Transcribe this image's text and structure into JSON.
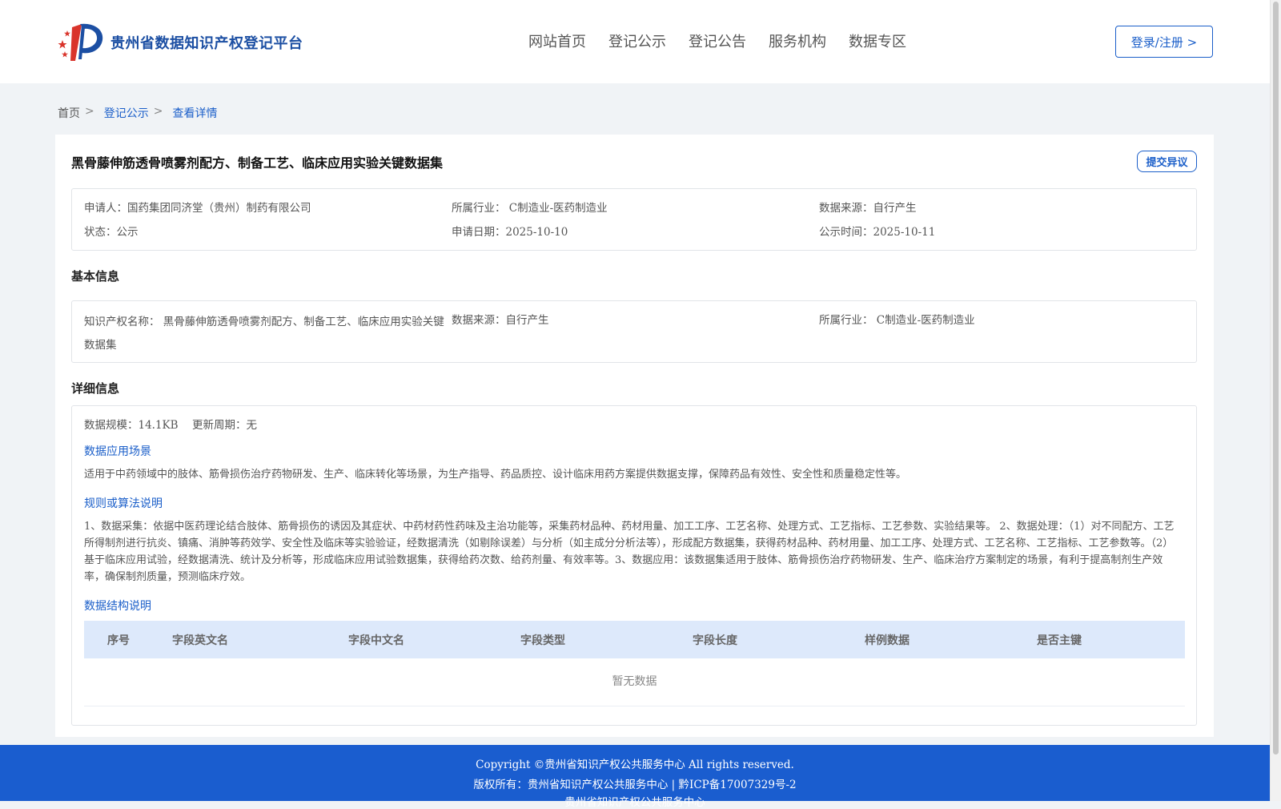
{
  "header": {
    "site_title": "贵州省数据知识产权登记平台",
    "nav": [
      "网站首页",
      "登记公示",
      "登记公告",
      "服务机构",
      "数据专区"
    ],
    "login_label": "登录/注册 >"
  },
  "breadcrumb": {
    "home": "首页",
    "section": "登记公示",
    "current": "查看详情",
    "separator": ">"
  },
  "record": {
    "title": "黑骨藤伸筋透骨喷雾剂配方、制备工艺、临床应用实验关键数据集",
    "dispute_label": "提交异议",
    "summary": {
      "applicant": "申请人：国药集团同济堂（贵州）制药有限公司",
      "industry": "所属行业： C制造业-医药制造业",
      "source": "数据来源：自行产生",
      "status": "状态：公示",
      "apply_date": "申请日期：2025-10-10",
      "publish_date": "公示时间：2025-10-11"
    }
  },
  "basic": {
    "heading": "基本信息",
    "name": "知识产权名称： 黑骨藤伸筋透骨喷雾剂配方、制备工艺、临床应用实验关键数据集",
    "source": "数据来源：自行产生",
    "industry": "所属行业： C制造业-医药制造业"
  },
  "detail": {
    "heading": "详细信息",
    "scale": "数据规模：14.1KB",
    "cycle": "更新周期：无",
    "scenario_heading": "数据应用场景",
    "scenario_text": "适用于中药领域中的肢体、筋骨损伤治疗药物研发、生产、临床转化等场景，为生产指导、药品质控、设计临床用药方案提供数据支撑，保障药品有效性、安全性和质量稳定性等。",
    "rules_heading": "规则或算法说明",
    "rules_text": "1、数据采集：依据中医药理论结合肢体、筋骨损伤的诱因及其症状、中药材药性药味及主治功能等，采集药材品种、药材用量、加工工序、工艺名称、处理方式、工艺指标、工艺参数、实验结果等。 2、数据处理：（1）对不同配方、工艺所得制剂进行抗炎、镇痛、消肿等药效学、安全性及临床等实验验证，经数据清洗（如剔除误差）与分析（如主成分分析法等），形成配方数据集，获得药材品种、药材用量、加工工序、处理方式、工艺名称、工艺指标、工艺参数等。（2）基于临床应用试验，经数据清洗、统计及分析等，形成临床应用试验数据集，获得给药次数、给药剂量、有效率等。3、数据应用：该数据集适用于肢体、筋骨损伤治疗药物研发、生产、临床治疗方案制定的场景，有利于提高制剂生产效率，确保制剂质量，预测临床疗效。",
    "structure_heading": "数据结构说明",
    "table_headers": [
      "序号",
      "字段英文名",
      "字段中文名",
      "字段类型",
      "字段长度",
      "样例数据",
      "是否主键"
    ],
    "empty_text": "暂无数据"
  },
  "footer": {
    "copyright": "Copyright ©贵州省知识产权公共服务中心 All rights reserved.",
    "owner": "版权所有：贵州省知识产权公共服务中心 | 黔ICP备17007329号-2",
    "org": "贵州省知识产权公共服务中心"
  },
  "colors": {
    "brand_blue": "#1a5ec9",
    "footer_blue": "#1a5dcf",
    "logo_red": "#d9342b"
  }
}
